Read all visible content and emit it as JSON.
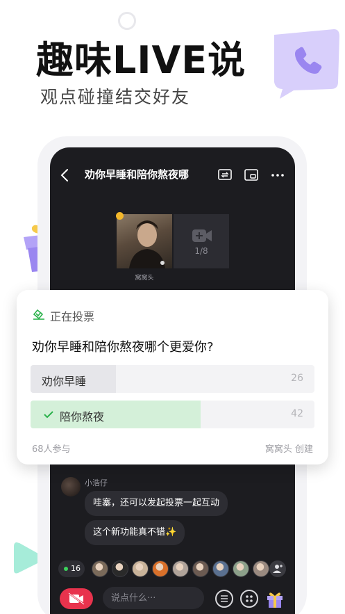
{
  "promo": {
    "headline": "趣味LIVE说",
    "subline": "观点碰撞结交好友"
  },
  "room": {
    "title": "劝你早睡和陪你熬夜哪",
    "seat_name": "窝窝头",
    "seat_count": "1/8"
  },
  "poll": {
    "status": "正在投票",
    "question": "劝你早睡和陪你熬夜哪个更爱你?",
    "options": [
      {
        "label": "劝你早睡",
        "votes": "26",
        "share": 0.3,
        "fill_color": "#e6e6ea",
        "selected": false
      },
      {
        "label": "陪你熬夜",
        "votes": "42",
        "share": 0.6,
        "fill_color": "#d4f0d9",
        "selected": true
      }
    ],
    "participants": "68人参与",
    "creator": "窝窝头 创建",
    "accent": "#2bb24c"
  },
  "chat": {
    "user": "小浩仔",
    "messages": [
      "哇塞，还可以发起投票一起互动",
      "这个新功能真不错✨"
    ]
  },
  "audience": {
    "online_count": "16",
    "avatar_colors": [
      "#7a6a5a",
      "#2a2a2a",
      "#c9b39a",
      "#d9702a",
      "#b0a39a",
      "#6c5b52",
      "#5a7090",
      "#8ca08a",
      "#9a8a80"
    ]
  },
  "composer": {
    "placeholder": "说点什么···"
  },
  "colors": {
    "purple": "#9a86f0",
    "purple_light": "#d8cffb",
    "gift_yellow": "#f6c94a",
    "live_red": "#e8334d"
  }
}
